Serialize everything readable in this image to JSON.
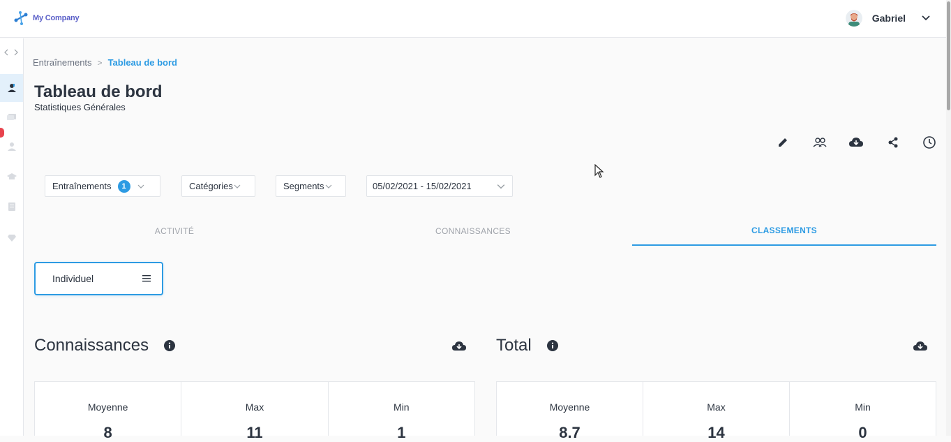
{
  "app": {
    "company_name": "My Company"
  },
  "user": {
    "name": "Gabriel"
  },
  "breadcrumb": {
    "parent": "Entraînements",
    "separator": ">",
    "current": "Tableau de bord"
  },
  "page": {
    "title": "Tableau de bord",
    "subtitle": "Statistiques Générales"
  },
  "actions": [
    "pencil-icon",
    "users-icon",
    "cloud-download-icon",
    "share-icon",
    "clock-icon"
  ],
  "filters": {
    "trainings": {
      "label": "Entraînements",
      "count": "1"
    },
    "categories": {
      "label": "Catégories"
    },
    "segments": {
      "label": "Segments"
    },
    "date_range": {
      "value": "05/02/2021 - 15/02/2021"
    }
  },
  "tabs": [
    {
      "label": "ACTIVITÉ",
      "active": false
    },
    {
      "label": "CONNAISSANCES",
      "active": false
    },
    {
      "label": "CLASSEMENTS",
      "active": true
    }
  ],
  "view_select": {
    "value": "Individuel"
  },
  "sections": [
    {
      "title": "Connaissances",
      "stats": [
        {
          "label": "Moyenne",
          "value": "8"
        },
        {
          "label": "Max",
          "value": "11"
        },
        {
          "label": "Min",
          "value": "1"
        }
      ]
    },
    {
      "title": "Total",
      "stats": [
        {
          "label": "Moyenne",
          "value": "8.7"
        },
        {
          "label": "Max",
          "value": "14"
        },
        {
          "label": "Min",
          "value": "0"
        }
      ]
    }
  ],
  "colors": {
    "accent": "#2d9be3",
    "text": "#2c3440",
    "muted": "#a0a4ab",
    "badge": "#e8434d"
  }
}
